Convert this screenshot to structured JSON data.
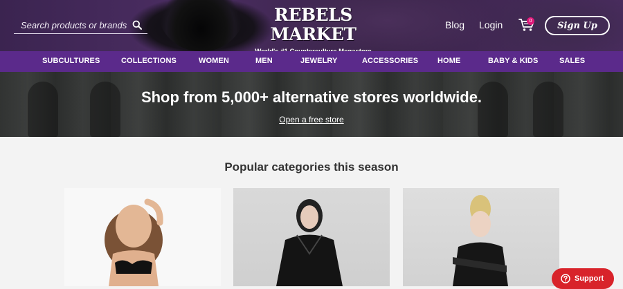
{
  "header": {
    "search": {
      "placeholder": "Search products or brands"
    },
    "logo": {
      "name": "REBELS MARKET",
      "tagline": "World's #1 Counterculture Megastore"
    },
    "blog_label": "Blog",
    "login_label": "Login",
    "cart": {
      "count": "0"
    },
    "signup_label": "Sign Up"
  },
  "categories": [
    "SUBCULTURES",
    "COLLECTIONS",
    "WOMEN",
    "MEN",
    "JEWELRY",
    "ACCESSORIES",
    "HOME",
    "BABY & KIDS",
    "SALES"
  ],
  "hero": {
    "title": "Shop from 5,000+ alternative stores worldwide.",
    "link_label": "Open a free store"
  },
  "popular": {
    "title": "Popular categories this season"
  },
  "support": {
    "label": "Support"
  },
  "colors": {
    "brand_purple": "#5b2a8b",
    "support_red": "#d8232a",
    "cart_badge": "#e0197a"
  }
}
